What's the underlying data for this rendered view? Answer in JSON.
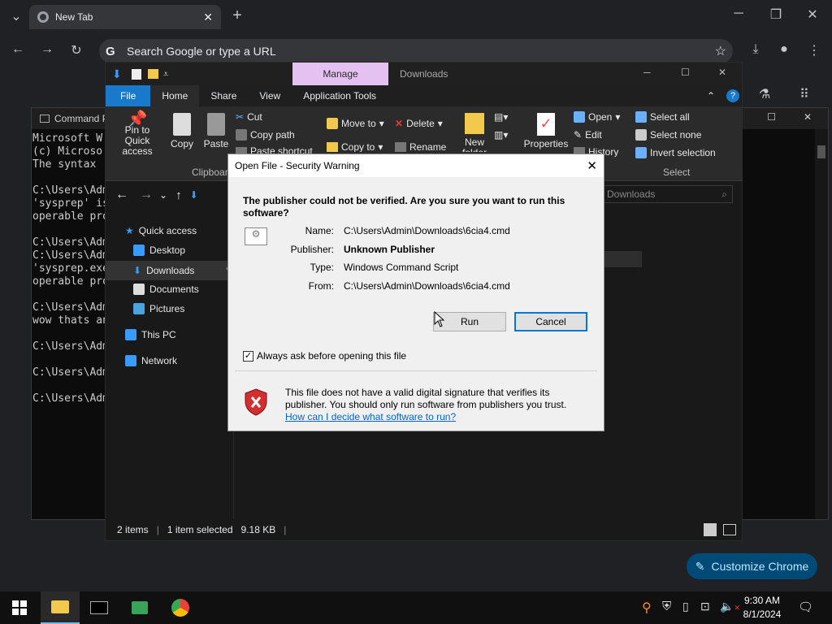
{
  "chrome": {
    "tab_title": "New Tab",
    "omnibox_placeholder": "Search Google or type a URL",
    "customize_label": "Customize Chrome"
  },
  "cmd": {
    "title": "Command Prompt",
    "lines": [
      "Microsoft W",
      "(c) Microso",
      "The syntax",
      "",
      "C:\\Users\\Adm",
      "'sysprep' is",
      "operable pro",
      "",
      "C:\\Users\\Adm",
      "C:\\Users\\Adm",
      "'sysprep.exe",
      "operable pro",
      "",
      "C:\\Users\\Adm",
      "wow thats an",
      "",
      "C:\\Users\\Adm",
      "",
      "C:\\Users\\Adm",
      "",
      "C:\\Users\\Adm"
    ]
  },
  "explorer": {
    "title": "Downloads",
    "manage_label": "Manage",
    "tabs": [
      "File",
      "Home",
      "Share",
      "View",
      "Application Tools"
    ],
    "ribbon": {
      "pin": "Pin to Quick access",
      "copy": "Copy",
      "paste": "Paste",
      "cut": "Cut",
      "copy_path": "Copy path",
      "paste_shortcut": "Paste shortcut",
      "clipboard": "Clipboard",
      "move_to": "Move to",
      "copy_to": "Copy to",
      "delete": "Delete",
      "rename": "Rename",
      "new_folder": "New folder",
      "properties": "Properties",
      "open": "Open",
      "edit": "Edit",
      "history": "History",
      "select_all": "Select all",
      "select_none": "Select none",
      "invert_selection": "Invert selection",
      "select_group": "Select"
    },
    "search_placeholder": "Downloads",
    "nav": {
      "quick_access": "Quick access",
      "desktop": "Desktop",
      "downloads": "Downloads",
      "documents": "Documents",
      "pictures": "Pictures",
      "this_pc": "This PC",
      "network": "Network"
    },
    "status": {
      "items": "2 items",
      "selected": "1 item selected",
      "size": "9.18 KB"
    }
  },
  "dialog": {
    "title": "Open File - Security Warning",
    "question": "The publisher could not be verified.  Are you sure you want to run this software?",
    "name_label": "Name:",
    "name_value": "C:\\Users\\Admin\\Downloads\\6cia4.cmd",
    "publisher_label": "Publisher:",
    "publisher_value": "Unknown Publisher",
    "type_label": "Type:",
    "type_value": "Windows Command Script",
    "from_label": "From:",
    "from_value": "C:\\Users\\Admin\\Downloads\\6cia4.cmd",
    "run_label": "Run",
    "cancel_label": "Cancel",
    "always_ask": "Always ask before opening this file",
    "warning_text": "This file does not have a valid digital signature that verifies its publisher.  You should only run software from publishers you trust.",
    "help_link": "How can I decide what software to run?"
  },
  "taskbar": {
    "time": "9:30 AM",
    "date": "8/1/2024"
  }
}
